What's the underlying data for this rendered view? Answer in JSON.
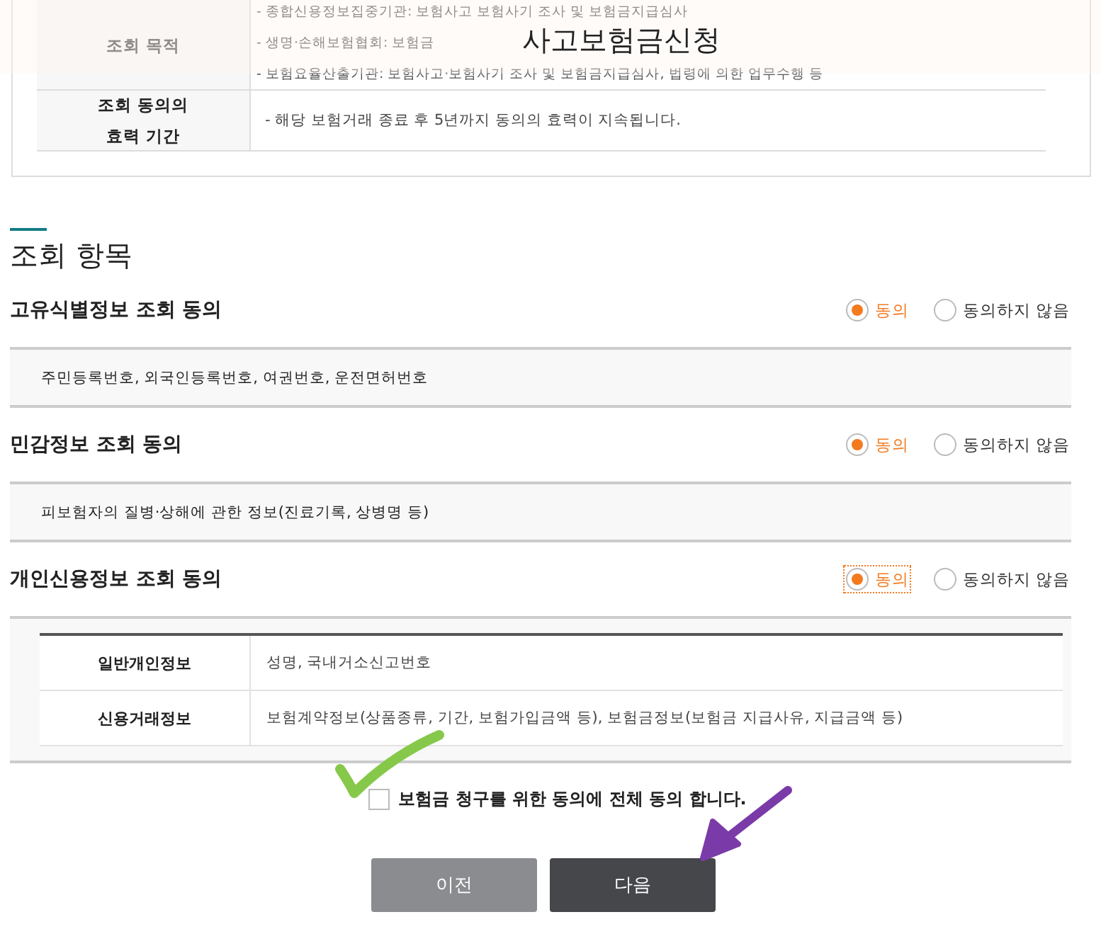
{
  "header": {
    "title": "사고보험금신청"
  },
  "purpose_table": {
    "rows": [
      {
        "label": "조회 목적",
        "lines": [
          "- 종합신용정보집중기관: 보험사고 보험사기 조사 및 보험금지급심사",
          "- 생명·손해보험협회: 보험금",
          "- 보험요율산출기관: 보험사고·보험사기 조사 및 보험금지급심사, 법령에 의한 업무수행 등"
        ]
      },
      {
        "label": "조회 동의의\n효력 기간",
        "lines": [
          "- 해당 보험거래 종료 후 5년까지 동의의 효력이 지속됩니다."
        ]
      }
    ]
  },
  "section": {
    "title": "조회 항목",
    "items": [
      {
        "title": "고유식별정보 조회 동의",
        "options": [
          {
            "label": "동의",
            "selected": true,
            "focused": false
          },
          {
            "label": "동의하지 않음",
            "selected": false,
            "focused": false
          }
        ],
        "kind": "text",
        "detail": "주민등록번호, 외국인등록번호, 여권번호, 운전면허번호"
      },
      {
        "title": "민감정보 조회 동의",
        "options": [
          {
            "label": "동의",
            "selected": true,
            "focused": false
          },
          {
            "label": "동의하지 않음",
            "selected": false,
            "focused": false
          }
        ],
        "kind": "text",
        "detail": "피보험자의 질병·상해에 관한 정보(진료기록, 상병명 등)"
      },
      {
        "title": "개인신용정보 조회 동의",
        "options": [
          {
            "label": "동의",
            "selected": true,
            "focused": true
          },
          {
            "label": "동의하지 않음",
            "selected": false,
            "focused": false
          }
        ],
        "kind": "table",
        "rows": [
          {
            "label": "일반개인정보",
            "value": "성명, 국내거소신고번호"
          },
          {
            "label": "신용거래정보",
            "value": "보험계약정보(상품종류, 기간, 보험가입금액 등), 보험금정보(보험금 지급사유, 지급금액 등)"
          }
        ]
      }
    ]
  },
  "agree_all": {
    "label": "보험금 청구를 위한 동의에 전체 동의 합니다.",
    "checked": false
  },
  "buttons": [
    {
      "label": "이전",
      "kind": "secondary"
    },
    {
      "label": "다음",
      "kind": "primary"
    }
  ]
}
